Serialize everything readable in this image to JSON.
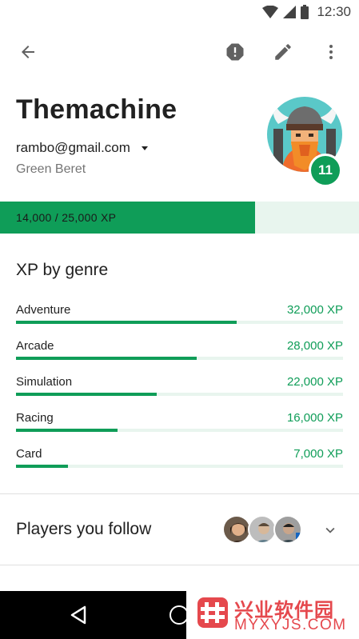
{
  "status_bar": {
    "time": "12:30"
  },
  "profile": {
    "name": "Themachine",
    "email": "rambo@gmail.com",
    "rank": "Green Beret",
    "level": "11",
    "xp_label": "14,000 / 25,000 XP",
    "xp_progress": 0.71
  },
  "genres": {
    "title": "XP by genre",
    "items": [
      {
        "name": "Adventure",
        "xp": "32,000 XP",
        "progress": 0.675
      },
      {
        "name": "Arcade",
        "xp": "28,000 XP",
        "progress": 0.553
      },
      {
        "name": "Simulation",
        "xp": "22,000 XP",
        "progress": 0.431
      },
      {
        "name": "Racing",
        "xp": "16,000 XP",
        "progress": 0.311
      },
      {
        "name": "Card",
        "xp": "7,000 XP",
        "progress": 0.159
      }
    ]
  },
  "following": {
    "title": "Players you follow"
  },
  "watermark": {
    "cn": "兴业软件园",
    "en": "MYXYJS.COM"
  },
  "colors": {
    "accent": "#0f9d58",
    "accent_light": "#e8f5ee",
    "text": "#212121",
    "secondary_text": "#757575"
  },
  "icons": {
    "app_bar": [
      "back-arrow-icon",
      "report-icon",
      "edit-pencil-icon",
      "more-vert-icon"
    ],
    "status_bar": [
      "wifi-icon",
      "cell-signal-icon",
      "battery-icon"
    ],
    "nav_bar": [
      "nav-back-icon",
      "nav-home-icon"
    ]
  }
}
